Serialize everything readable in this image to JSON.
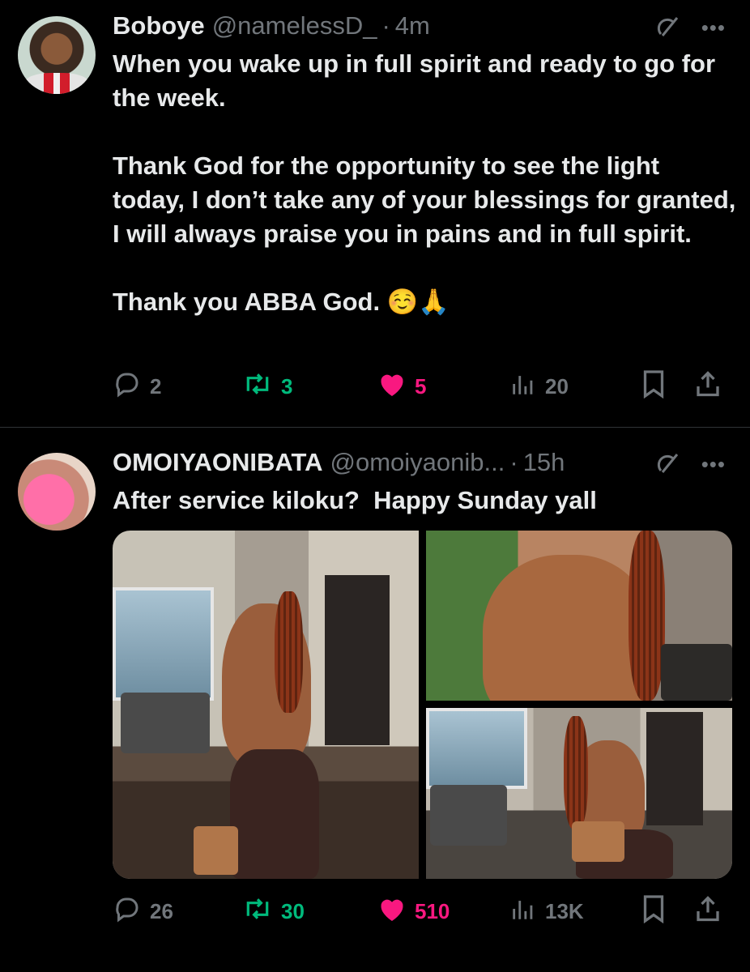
{
  "tweets": [
    {
      "display_name": "Boboye",
      "handle": "@namelessD_",
      "dot": "·",
      "time": "4m",
      "text": "When you wake up in full spirit and ready to go for the week.\n\nThank God for the opportunity to see the light today, I don’t take any of your blessings for granted,  I will always praise you in pains and in full spirit.\n\nThank you ABBA God. ☺️🙏",
      "replies": "2",
      "reposts": "3",
      "likes": "5",
      "views": "20",
      "liked": true
    },
    {
      "display_name": "OMOIYAONIBATA",
      "handle": "@omoiyaonib...",
      "dot": "·",
      "time": "15h",
      "text": "After service kiloku?  Happy Sunday yall",
      "replies": "26",
      "reposts": "30",
      "likes": "510",
      "views": "13K",
      "liked": true,
      "media_count": 3
    }
  ],
  "icons": {
    "grok": "grok-icon",
    "more": "more-icon",
    "reply": "reply-icon",
    "repost": "repost-icon",
    "like": "heart-icon",
    "views": "views-icon",
    "bookmark": "bookmark-icon",
    "share": "share-icon"
  },
  "colors": {
    "background": "#000000",
    "text": "#e7e9ea",
    "muted": "#71767b",
    "repost": "#00ba7c",
    "like": "#f91880",
    "divider": "#2f3336"
  }
}
